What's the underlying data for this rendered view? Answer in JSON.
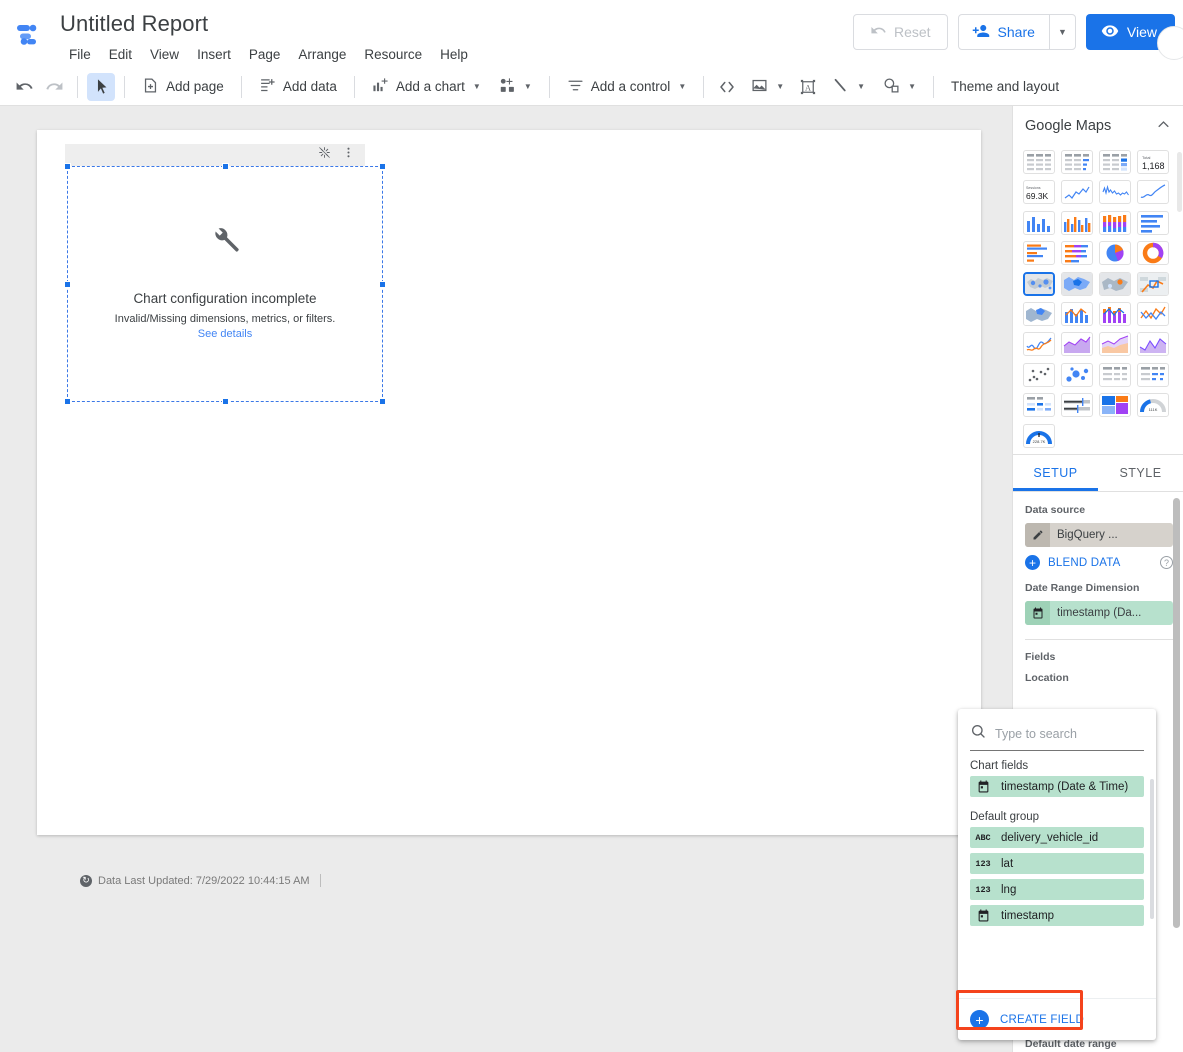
{
  "header": {
    "logo_icon": "looker-studio-logo",
    "title": "Untitled Report",
    "menus": [
      "File",
      "Edit",
      "View",
      "Insert",
      "Page",
      "Arrange",
      "Resource",
      "Help"
    ],
    "reset_label": "Reset",
    "reset_icon": "undo-icon",
    "share_label": "Share",
    "share_icon": "person-add-icon",
    "share_caret_icon": "chevron-down-icon",
    "view_label": "View",
    "view_icon": "eye-icon",
    "avatar_icon": "avatar"
  },
  "toolbar": {
    "undo_icon": "undo-icon",
    "redo_icon": "redo-icon",
    "select_icon": "cursor-arrow-icon",
    "add_page_label": "Add page",
    "add_page_icon": "add-page-icon",
    "add_data_label": "Add data",
    "add_data_icon": "add-data-icon",
    "add_chart_label": "Add a chart",
    "add_chart_icon": "bar-chart-plus-icon",
    "community_viz_icon": "community-visualization-icon",
    "add_control_label": "Add a control",
    "add_control_icon": "filter-icon",
    "embed_icon": "embed-code-icon",
    "image_icon": "image-icon",
    "text_icon": "text-box-icon",
    "line_icon": "line-icon",
    "shape_icon": "shape-icon",
    "theme_label": "Theme and layout"
  },
  "canvas": {
    "chart_header_icons": [
      "wand-off-icon",
      "more-vert-icon"
    ],
    "empty_state": {
      "icon": "wrench-icon",
      "title": "Chart configuration incomplete",
      "subtitle": "Invalid/Missing dimensions, metrics, or filters.",
      "link": "See details"
    },
    "footer": {
      "refresh_icon": "refresh-data-icon",
      "text": "Data Last Updated: 7/29/2022 10:44:15 AM"
    }
  },
  "right_panel": {
    "title": "Google Maps",
    "collapse_icon": "chevron-up-icon",
    "gallery": [
      {
        "name": "table",
        "selected": false
      },
      {
        "name": "table-with-bars",
        "selected": false
      },
      {
        "name": "table-with-heatmap",
        "selected": false
      },
      {
        "name": "scorecard",
        "selected": false,
        "label_top": "Total",
        "label_main": "1,168"
      },
      {
        "name": "scorecard-compact",
        "selected": false,
        "label_top": "Sessions",
        "label_main": "69.3K"
      },
      {
        "name": "time-series",
        "selected": false
      },
      {
        "name": "sparkline",
        "selected": false
      },
      {
        "name": "smoothed-time-series",
        "selected": false
      },
      {
        "name": "column-chart",
        "selected": false
      },
      {
        "name": "grouped-column-chart",
        "selected": false
      },
      {
        "name": "stacked-column-chart",
        "selected": false
      },
      {
        "name": "bar-chart",
        "selected": false
      },
      {
        "name": "grouped-bar-chart",
        "selected": false
      },
      {
        "name": "stacked-bar-chart",
        "selected": false
      },
      {
        "name": "pie-chart",
        "selected": false
      },
      {
        "name": "donut-chart",
        "selected": false
      },
      {
        "name": "google-maps-bubble",
        "selected": true
      },
      {
        "name": "google-maps-filled",
        "selected": false
      },
      {
        "name": "google-maps-heatmap",
        "selected": false
      },
      {
        "name": "google-maps-lines",
        "selected": false
      },
      {
        "name": "geo-chart",
        "selected": false
      },
      {
        "name": "combo-chart",
        "selected": false
      },
      {
        "name": "stacked-combo-chart",
        "selected": false
      },
      {
        "name": "line-chart",
        "selected": false
      },
      {
        "name": "smoothed-line-chart",
        "selected": false
      },
      {
        "name": "area-chart",
        "selected": false
      },
      {
        "name": "stacked-area-chart",
        "selected": false
      },
      {
        "name": "mixed-area-chart",
        "selected": false
      },
      {
        "name": "scatter-chart",
        "selected": false
      },
      {
        "name": "bubble-chart",
        "selected": false
      },
      {
        "name": "pivot-table",
        "selected": false
      },
      {
        "name": "pivot-table-bars",
        "selected": false
      },
      {
        "name": "pivot-table-heatmap",
        "selected": false
      },
      {
        "name": "bullet-chart",
        "selected": false
      },
      {
        "name": "treemap",
        "selected": false
      },
      {
        "name": "gauge-small",
        "selected": false,
        "label_main": "111K"
      },
      {
        "name": "gauge-large",
        "selected": false,
        "label_main": "228.7K"
      }
    ],
    "tabs": [
      {
        "label": "SETUP",
        "active": true
      },
      {
        "label": "STYLE",
        "active": false
      }
    ],
    "data_source_label": "Data source",
    "data_source_value": "BigQuery ...",
    "data_source_icon": "pencil-icon",
    "blend_data_label": "BLEND DATA",
    "blend_plus_icon": "plus-circle-icon",
    "blend_help_icon": "help-icon",
    "date_range_label": "Date Range Dimension",
    "date_range_value": "timestamp (Da...",
    "date_range_icon": "calendar-icon",
    "fields_label": "Fields",
    "location_label": "Location",
    "default_date_range_label": "Default date range"
  },
  "field_dropdown": {
    "search_icon": "search-icon",
    "search_placeholder": "Type to search",
    "search_value": "",
    "groups": [
      {
        "label": "Chart fields",
        "fields": [
          {
            "icon": "calendar-icon",
            "icon_text": "",
            "label": "timestamp (Date & Time)"
          }
        ]
      },
      {
        "label": "Default group",
        "fields": [
          {
            "icon": "abc-icon",
            "icon_text": "ABC",
            "label": "delivery_vehicle_id"
          },
          {
            "icon": "number-icon",
            "icon_text": "123",
            "label": "lat"
          },
          {
            "icon": "number-icon",
            "icon_text": "123",
            "label": "lng"
          },
          {
            "icon": "calendar-icon",
            "icon_text": "",
            "label": "timestamp"
          }
        ]
      }
    ],
    "create_field_label": "CREATE FIELD",
    "create_field_icon": "plus-circle-icon",
    "highlight_color": "#f4431c"
  },
  "colors": {
    "accent_blue": "#1a73e8",
    "field_green": "#b7e1cd",
    "data_source_tan": "#d6d2cc",
    "canvas_gray": "#ebebeb",
    "highlight_orange": "#f4431c"
  }
}
